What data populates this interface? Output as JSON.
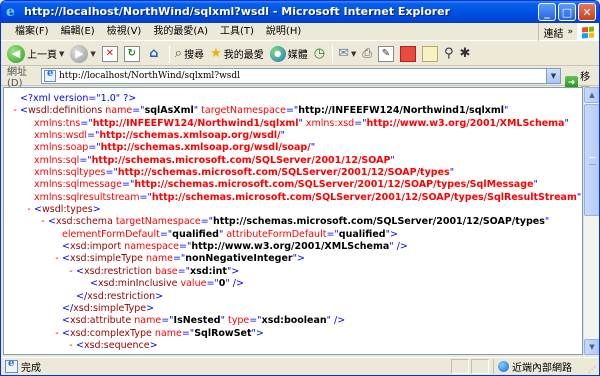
{
  "window": {
    "title": "http://localhost/NorthWind/sqlxml?wsdl - Microsoft Internet Explorer",
    "minimize": "_",
    "maximize": "□",
    "close": "✕"
  },
  "menu": {
    "items": [
      "檔案(F)",
      "編輯(E)",
      "檢視(V)",
      "我的最愛(A)",
      "工具(T)",
      "說明(H)"
    ],
    "links": "連結",
    "links_chevron": "»"
  },
  "toolbar": {
    "back": "上一頁",
    "search": "搜尋",
    "favorites": "我的最愛",
    "media": "媒體"
  },
  "address": {
    "label": "網址(D)",
    "url": "http://localhost/NorthWind/sqlxml?wsdl",
    "go": "移至"
  },
  "xml_lines": [
    {
      "m": "",
      "indent": 0,
      "html": "<span class=\"b\">&lt;?</span><span class=\"pi\">xml version=\"1.0\" </span><span class=\"b\">?&gt;</span>"
    },
    {
      "m": "-",
      "indent": 0,
      "html": "<span class=\"b\">&lt;</span><span class=\"tag\">wsdl:definitions</span> <span class=\"an\">name</span><span class=\"b\">=\"</span><span class=\"av\">sqlAsXml</span><span class=\"b\">\"</span> <span class=\"an\">targetNamespace</span><span class=\"b\">=\"</span><span class=\"av\">http://INFEEFW124/Northwind1/sqlxml</span><span class=\"b\">\"</span>"
    },
    {
      "m": "",
      "indent": 1,
      "html": "<span class=\"an\">xmlns:tns</span><span class=\"b\">=\"</span><span class=\"an av2\"><b style=\"color:#ff0000\">http://INFEEFW124/Northwind1/sqlxml</b></span><span class=\"b\">\"</span> <span class=\"an\">xmlns:xsd</span><span class=\"b\">=\"</span><b style=\"color:#ff0000\">http://www.w3.org/2001/XMLSchema</b><span class=\"b\">\"</span>"
    },
    {
      "m": "",
      "indent": 1,
      "html": "<span class=\"an\">xmlns:wsdl</span><span class=\"b\">=\"</span><b style=\"color:#ff0000\">http://schemas.xmlsoap.org/wsdl/</b><span class=\"b\">\"</span>"
    },
    {
      "m": "",
      "indent": 1,
      "html": "<span class=\"an\">xmlns:soap</span><span class=\"b\">=\"</span><b style=\"color:#ff0000\">http://schemas.xmlsoap.org/wsdl/soap/</b><span class=\"b\">\"</span>"
    },
    {
      "m": "",
      "indent": 1,
      "html": "<span class=\"an\">xmlns:sql</span><span class=\"b\">=\"</span><b style=\"color:#ff0000\">http://schemas.microsoft.com/SQLServer/2001/12/SOAP</b><span class=\"b\">\"</span>"
    },
    {
      "m": "",
      "indent": 1,
      "html": "<span class=\"an\">xmlns:sqltypes</span><span class=\"b\">=\"</span><b style=\"color:#ff0000\">http://schemas.microsoft.com/SQLServer/2001/12/SOAP/types</b><span class=\"b\">\"</span>"
    },
    {
      "m": "",
      "indent": 1,
      "html": "<span class=\"an\">xmlns:sqlmessage</span><span class=\"b\">=\"</span><b style=\"color:#ff0000\">http://schemas.microsoft.com/SQLServer/2001/12/SOAP/types/SqlMessage</b><span class=\"b\">\"</span>"
    },
    {
      "m": "",
      "indent": 1,
      "html": "<span class=\"an\">xmlns:sqlresultstream</span><span class=\"b\">=\"</span><b style=\"color:#ff0000\">http://schemas.microsoft.com/SQLServer/2001/12/SOAP/types/SqlResultStream</b><span class=\"b\">\"&gt;</span>"
    },
    {
      "m": "-",
      "indent": 1,
      "html": "<span class=\"b\">&lt;</span><span class=\"tag\">wsdl:types</span><span class=\"b\">&gt;</span>"
    },
    {
      "m": "-",
      "indent": 2,
      "html": "<span class=\"b\">&lt;</span><span class=\"tag\">xsd:schema</span> <span class=\"an\">targetNamespace</span><span class=\"b\">=\"</span><span class=\"av\">http://schemas.microsoft.com/SQLServer/2001/12/SOAP/types</span><span class=\"b\">\"</span>"
    },
    {
      "m": "",
      "indent": 3,
      "html": "<span class=\"an\">elementFormDefault</span><span class=\"b\">=\"</span><span class=\"av\">qualified</span><span class=\"b\">\"</span> <span class=\"an\">attributeFormDefault</span><span class=\"b\">=\"</span><span class=\"av\">qualified</span><span class=\"b\">\"&gt;</span>"
    },
    {
      "m": "",
      "indent": 3,
      "html": "<span class=\"b\">&lt;</span><span class=\"tag\">xsd:import</span> <span class=\"an\">namespace</span><span class=\"b\">=\"</span><span class=\"av\">http://www.w3.org/2001/XMLSchema</span><span class=\"b\">\" /&gt;</span>"
    },
    {
      "m": "-",
      "indent": 3,
      "html": "<span class=\"b\">&lt;</span><span class=\"tag\">xsd:simpleType</span> <span class=\"an\">name</span><span class=\"b\">=\"</span><span class=\"av\">nonNegativeInteger</span><span class=\"b\">\"&gt;</span>"
    },
    {
      "m": "-",
      "indent": 4,
      "html": "<span class=\"b\">&lt;</span><span class=\"tag\">xsd:restriction</span> <span class=\"an\">base</span><span class=\"b\">=\"</span><span class=\"av\">xsd:int</span><span class=\"b\">\"&gt;</span>"
    },
    {
      "m": "",
      "indent": 5,
      "html": "<span class=\"b\">&lt;</span><span class=\"tag\">xsd:minInclusive</span> <span class=\"an\">value</span><span class=\"b\">=\"</span><span class=\"av\">0</span><span class=\"b\">\" /&gt;</span>"
    },
    {
      "m": "",
      "indent": 4,
      "html": "<span class=\"b\">&lt;/</span><span class=\"tag\">xsd:restriction</span><span class=\"b\">&gt;</span>"
    },
    {
      "m": "",
      "indent": 3,
      "html": "<span class=\"b\">&lt;/</span><span class=\"tag\">xsd:simpleType</span><span class=\"b\">&gt;</span>"
    },
    {
      "m": "",
      "indent": 3,
      "html": "<span class=\"b\">&lt;</span><span class=\"tag\">xsd:attribute</span> <span class=\"an\">name</span><span class=\"b\">=\"</span><span class=\"av\">IsNested</span><span class=\"b\">\"</span> <span class=\"an\">type</span><span class=\"b\">=\"</span><span class=\"av\">xsd:boolean</span><span class=\"b\">\" /&gt;</span>"
    },
    {
      "m": "-",
      "indent": 3,
      "html": "<span class=\"b\">&lt;</span><span class=\"tag\">xsd:complexType</span> <span class=\"an\">name</span><span class=\"b\">=\"</span><span class=\"av\">SqlRowSet</span><span class=\"b\">\"&gt;</span>"
    },
    {
      "m": "-",
      "indent": 4,
      "html": "<span class=\"b\">&lt;</span><span class=\"tag\">xsd:sequence</span><span class=\"b\">&gt;</span>"
    }
  ],
  "status": {
    "text": "完成",
    "zone": "近端內部網路"
  }
}
